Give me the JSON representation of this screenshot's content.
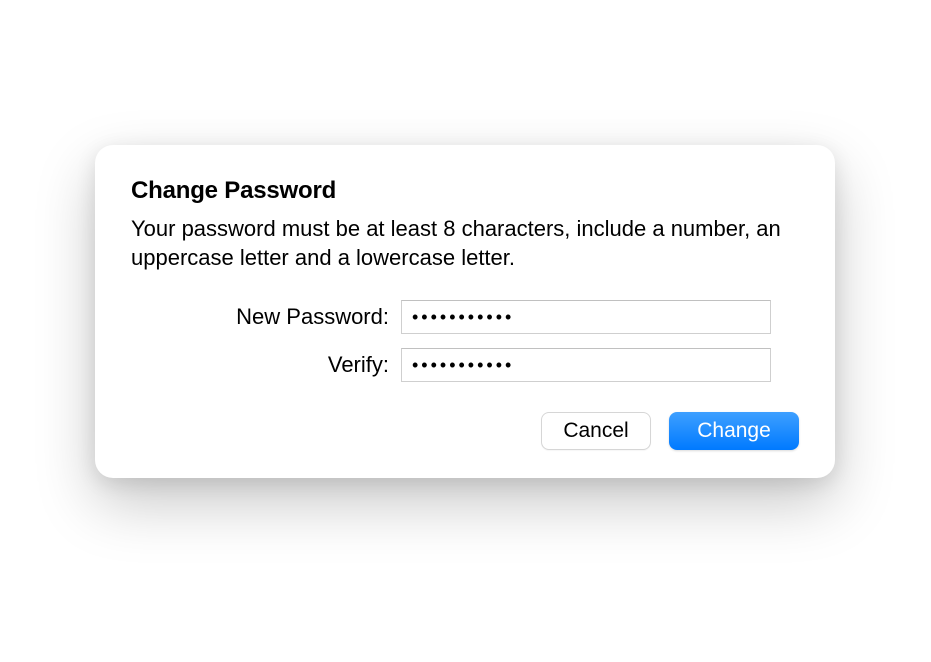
{
  "dialog": {
    "title": "Change Password",
    "description": "Your password must be at least 8 characters, include a number, an uppercase letter and a lowercase letter.",
    "fields": {
      "new_password": {
        "label": "New Password:",
        "value": "•••••••••••"
      },
      "verify": {
        "label": "Verify:",
        "value": "•••••••••••"
      }
    },
    "buttons": {
      "cancel": "Cancel",
      "change": "Change"
    }
  }
}
